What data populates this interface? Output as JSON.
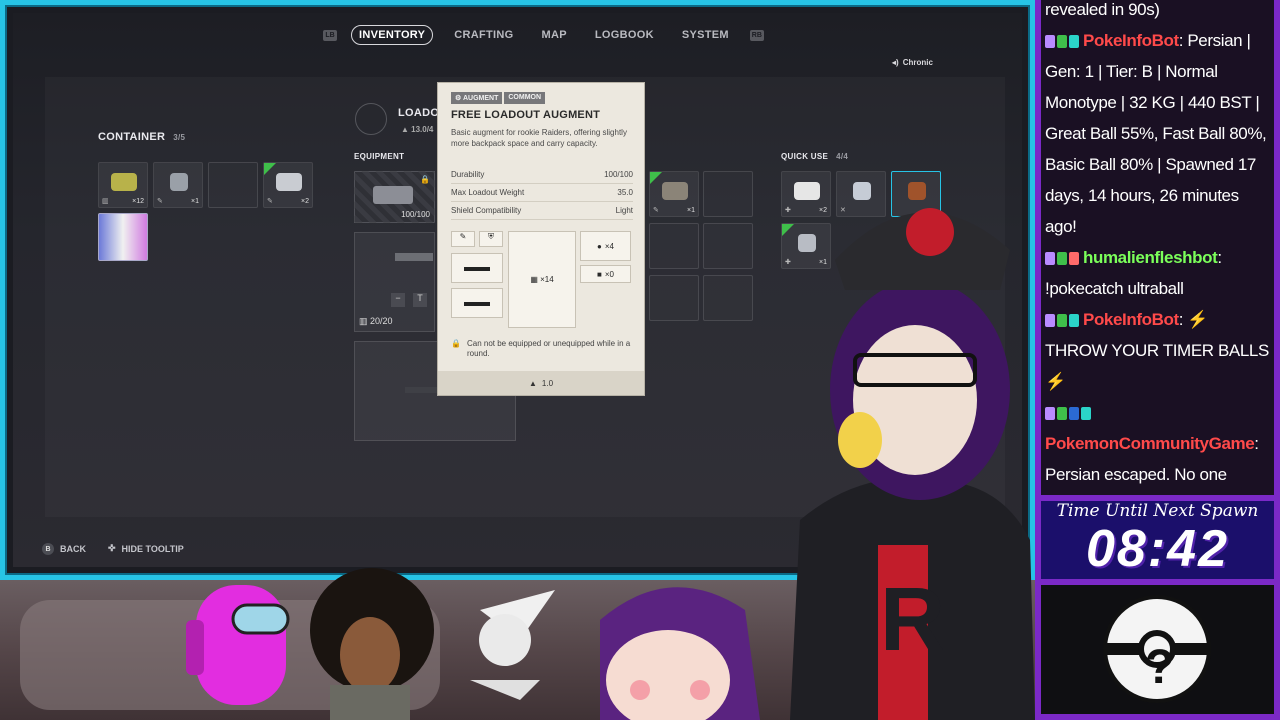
{
  "nav": {
    "left_hint": "LB",
    "right_hint": "RB",
    "tabs": [
      "INVENTORY",
      "CRAFTING",
      "MAP",
      "LOGBOOK",
      "SYSTEM"
    ]
  },
  "audio": {
    "label": "Chronic"
  },
  "container": {
    "title": "CONTAINER",
    "count": "3/5",
    "slot_counts": [
      "×12",
      "×1",
      "",
      "×2"
    ]
  },
  "equipment": {
    "title": "EQUIPMENT",
    "augment_durability": "100/100",
    "ammo": "20/20",
    "loadout_title": "LOADO",
    "weight": "13.0/4"
  },
  "quick_use": {
    "title": "QUICK USE",
    "count": "4/4",
    "counts": [
      "×2",
      "",
      "",
      "×1"
    ]
  },
  "backpack_counts": [
    "×1"
  ],
  "tooltip": {
    "tag1": "AUGMENT",
    "tag2": "COMMON",
    "title": "FREE LOADOUT AUGMENT",
    "description": "Basic augment for rookie Raiders, offering slightly more backpack space and carry capacity.",
    "stats": [
      {
        "label": "Durability",
        "value": "100/100"
      },
      {
        "label": "Max Loadout Weight",
        "value": "35.0"
      },
      {
        "label": "Shield Compatibility",
        "value": "Light"
      }
    ],
    "grid_label": "▦ ×14",
    "side_a": "×4",
    "side_b": "×0",
    "note": "Can not be equipped or unequipped while in a round.",
    "weight": "1.0"
  },
  "hints": {
    "back": "BACK",
    "back_key": "B",
    "hide": "HIDE TOOLTIP"
  },
  "chat": {
    "lines": [
      {
        "text": "revealed in 90s)"
      },
      {
        "user": "PokeInfoBot",
        "text": ": Persian | Gen: 1 | Tier: B | Normal Monotype | 32 KG | 440 BST | Great Ball 55%, Fast Ball 80%, Basic Ball 80% | Spawned 17 days, 14 hours, 26 minutes ago!"
      },
      {
        "user": "humalienfleshbot",
        "text": ": !pokecatch ultraball"
      },
      {
        "user": "PokeInfoBot",
        "text": ": ⚡ THROW YOUR TIMER BALLS ⚡"
      },
      {
        "user": "PokemonCommunityGame",
        "text": ": Persian escaped. No one caught it."
      }
    ]
  },
  "timer": {
    "label": "Time Until Next Spawn",
    "value": "08:42"
  },
  "colors": {
    "frame": "#27c4e6",
    "chat_border": "#7b29c7",
    "timer_bg": "#1b0f6b",
    "bot_red": "#ff4a4a",
    "bot_green": "#7bff5a"
  }
}
